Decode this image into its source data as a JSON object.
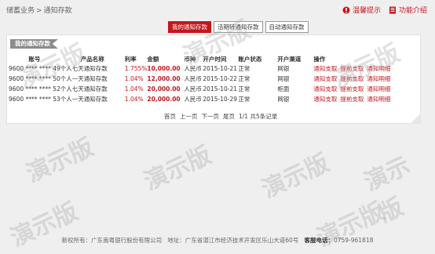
{
  "breadcrumb": {
    "root": "储蓄业务",
    "sep": ">",
    "current": "通知存款"
  },
  "top_links": {
    "tip": "温馨提示",
    "help": "功能介绍"
  },
  "tabs": [
    {
      "label": "我的通知存款"
    },
    {
      "label": "活期转通知存款"
    },
    {
      "label": "自动通知存款"
    }
  ],
  "section_title": "我的通知存款",
  "table": {
    "headers": [
      "账号",
      "产品名称",
      "利率",
      "金额",
      "币种",
      "开户时间",
      "账户状态",
      "开户渠道",
      "操作"
    ],
    "rows": [
      {
        "account": "9600 **** **** 49",
        "product": "个人七天通知存款",
        "rate": "1.755%",
        "amount": "10,000.00",
        "currency": "人民币",
        "date": "2015-10-21",
        "status": "正常",
        "channel": "网银",
        "ops": [
          "通知支取",
          "提前支取",
          "通知明细"
        ]
      },
      {
        "account": "9600 **** **** 50",
        "product": "个人一天通知存款",
        "rate": "1.04%",
        "amount": "12,000.00",
        "currency": "人民币",
        "date": "2015-10-22",
        "status": "正常",
        "channel": "网银",
        "ops": [
          "通知支取",
          "提前支取",
          "通知明细"
        ]
      },
      {
        "account": "9600 **** **** 52",
        "product": "个人七天通知存款",
        "rate": "1.04%",
        "amount": "20,000.00",
        "currency": "人民币",
        "date": "2015-10-21",
        "status": "正常",
        "channel": "柜面",
        "ops": [
          "通知支取",
          "提前支取",
          "通知明细"
        ]
      },
      {
        "account": "9600 **** **** 53",
        "product": "个人一天通知存款",
        "rate": "1.04%",
        "amount": "20,000.00",
        "currency": "人民币",
        "date": "2015-10-29",
        "status": "正常",
        "channel": "网银",
        "ops": [
          "通知支取",
          "提前支取",
          "通知明细"
        ]
      }
    ]
  },
  "pager": {
    "first": "首页",
    "prev": "上一页",
    "next": "下一页",
    "last": "尾页",
    "info": "1/1 共5条记录"
  },
  "watermark": "演示版",
  "footer": {
    "owner": "新权所有：广东南粤银行股份有限公司",
    "address": "地址：广东省湛江市经济技术开发区乐山大道60号",
    "phone_label": "客服电话：",
    "phone": "0759-961818"
  },
  "colors": {
    "accent": "#c4161c"
  }
}
